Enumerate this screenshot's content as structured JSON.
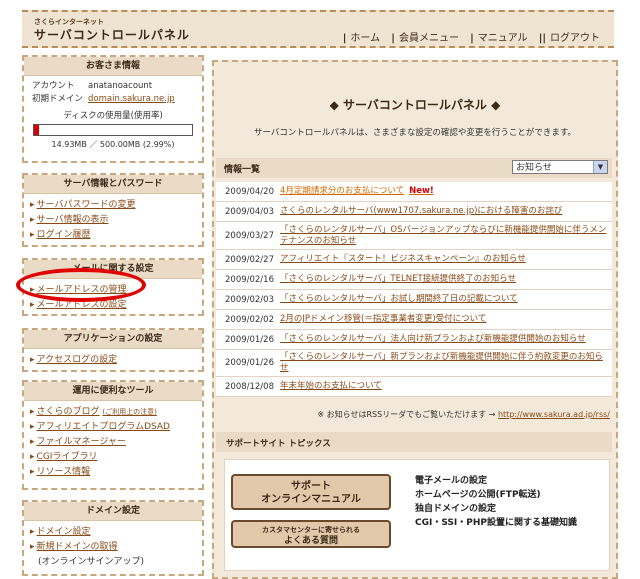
{
  "header": {
    "brand_small": "さくらインターネット",
    "brand_big": "サーバコントロールパネル",
    "nav": [
      "ホーム",
      "会員メニュー",
      "マニュアル",
      "ログアウト"
    ]
  },
  "customer": {
    "title": "お客さま情報",
    "account_label": "アカウント",
    "account_value": "anatanoacount",
    "domain_label": "初期ドメイン",
    "domain_value": "domain.sakura.ne.jp",
    "disk_label": "ディスクの使用量(使用率)",
    "disk_usage_text": "14.93MB ／ 500.00MB (2.99%)",
    "disk_usage_percent": 2.99
  },
  "server_info": {
    "title": "サーバ情報とパスワード",
    "items": [
      "サーバパスワードの変更",
      "サーバ情報の表示",
      "ログイン履歴"
    ]
  },
  "mail": {
    "title": "メールに関する設定",
    "items": [
      "メールアドレスの管理",
      "メールアドレスの設定"
    ]
  },
  "apps": {
    "title": "アプリケーションの設定",
    "items": [
      "アクセスログの設定"
    ]
  },
  "tools": {
    "title": "運用に便利なツール",
    "items": [
      "さくらのブログ",
      "アフィリエイトプログラムDSAD",
      "ファイルマネージャー",
      "CGIライブラリ",
      "リソース情報"
    ],
    "blog_note": "(ご利用上の注意)"
  },
  "domain": {
    "title": "ドメイン設定",
    "items": [
      "ドメイン設定",
      "新規ドメインの取得"
    ],
    "new_domain_note": "(オンラインサインアップ)"
  },
  "main": {
    "title": "◆ サーバコントロールパネル ◆",
    "desc": "サーバコントロールパネルは、さまざまな設定の確認や変更を行うことができます。"
  },
  "news": {
    "header": "情報一覧",
    "select_value": "お知らせ",
    "new_badge": "New!",
    "rows": [
      {
        "date": "2009/04/20",
        "title": "4月定期請求分のお支払について"
      },
      {
        "date": "2009/04/03",
        "title": "さくらのレンタルサーバ(www1707.sakura.ne.jp)における障害のお詫び"
      },
      {
        "date": "2009/03/27",
        "title": "「さくらのレンタルサーバ」OSバージョンアップならびに新機能提供開始に伴うメンテナンスのお知らせ"
      },
      {
        "date": "2009/02/27",
        "title": "アフィリエイト『スタート！ビジネスキャンペーン』のお知らせ"
      },
      {
        "date": "2009/02/16",
        "title": "「さくらのレンタルサーバ」TELNET接続提供終了のお知らせ"
      },
      {
        "date": "2009/02/03",
        "title": "「さくらのレンタルサーバ」お試し期間終了日の記載について"
      },
      {
        "date": "2009/02/02",
        "title": "2月のJPドメイン移管(＝指定事業者変更)受付について"
      },
      {
        "date": "2009/01/26",
        "title": "「さくらのレンタルサーバ」法人向け新プランおよび新機能提供開始のお知らせ"
      },
      {
        "date": "2009/01/26",
        "title": "「さくらのレンタルサーバ」新プランおよび新機能提供開始に伴う約款変更のお知らせ"
      },
      {
        "date": "2008/12/08",
        "title": "年末年始のお支払について"
      }
    ],
    "rss_note": "※ お知らせはRSSリーダでもご覧いただけます →",
    "rss_url": "http://www.sakura.ad.jp/rss/"
  },
  "support": {
    "header": "サポートサイト トピックス",
    "manual_button": "サポート\nオンラインマニュアル",
    "manual_l1": "サポート",
    "manual_l2": "オンラインマニュアル",
    "faq_small": "カスタマセンターに寄せられる",
    "faq_big": "よくある質問",
    "topics": [
      "電子メールの設定",
      "ホームページの公開(FTP転送)",
      "独自ドメインの設定",
      "CGI・SSI・PHP設置に関する基礎知識"
    ]
  },
  "colors": {
    "link": "#8a4a16",
    "accent_red": "#d40000",
    "panel_bg": "#f3e9da",
    "title_bg": "#eadbc6"
  }
}
